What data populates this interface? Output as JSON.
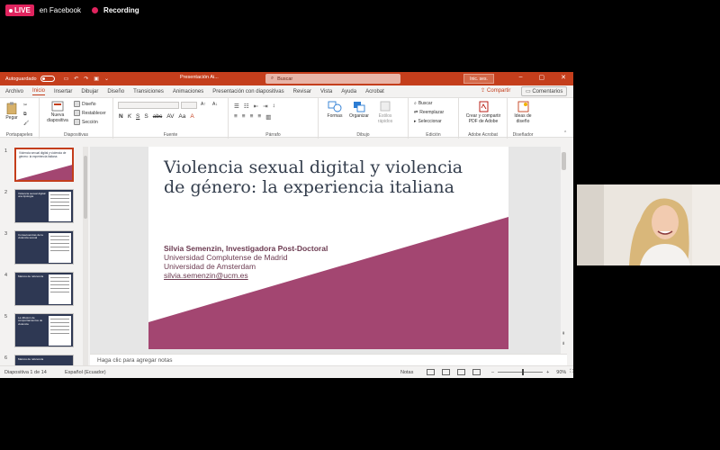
{
  "stream": {
    "live_label": "LIVE",
    "platform": "en Facebook",
    "recording_label": "Recording"
  },
  "window": {
    "autosave_label": "Autoguardado",
    "file_name": "Presentación Ai...",
    "search_placeholder": "Buscar",
    "signin_label": "Inic. ses."
  },
  "tabs": [
    "Archivo",
    "Inicio",
    "Insertar",
    "Dibujar",
    "Diseño",
    "Transiciones",
    "Animaciones",
    "Presentación con diapositivas",
    "Revisar",
    "Vista",
    "Ayuda",
    "Acrobat"
  ],
  "share_label": "Compartir",
  "comments_label": "Comentarios",
  "ribbon": {
    "paste": "Pegar",
    "new_slide": "Nueva diapositiva",
    "layout": "Diseño",
    "reset": "Restablecer",
    "section": "Sección",
    "shapes": "Formas",
    "arrange": "Organizar",
    "quick_styles": "Estilos rápidos",
    "find": "Buscar",
    "replace": "Reemplazar",
    "select": "Seleccionar",
    "create_pdf": "Crear y compartir PDF de Adobe",
    "design_ideas": "Ideas de diseño",
    "groups": {
      "clipboard": "Portapapeles",
      "slides": "Diapositivas",
      "font": "Fuente",
      "paragraph": "Párrafo",
      "drawing": "Dibujo",
      "editing": "Edición",
      "adobe": "Adobe Acrobat",
      "designer": "Diseñador"
    }
  },
  "thumbnails": [
    {
      "num": "1",
      "title": "Violencia sexual digital y violencia de género: la experiencia italiana"
    },
    {
      "num": "2",
      "title": "Violencia sexual digital: una tipología"
    },
    {
      "num": "3",
      "title": "Consecuencias de la violencia sexual"
    },
    {
      "num": "4",
      "title": "Marcos de referencia"
    },
    {
      "num": "5",
      "title": "La difusión de comportamientos de violencia"
    },
    {
      "num": "6",
      "title": "Marcos de referencia"
    }
  ],
  "slide": {
    "title": "Violencia sexual digital y violencia de género: la experiencia italiana",
    "author": "Silvia Semenzin, Investigadora Post-Doctoral",
    "affiliation1": "Universidad Complutense de Madrid",
    "affiliation2": "Universidad de Amsterdam",
    "email": "silvia.semenzin@ucm.es"
  },
  "notes_placeholder": "Haga clic para agregar notas",
  "status": {
    "slide_info": "Diapositiva 1 de 14",
    "language": "Español (Ecuador)",
    "notes_button": "Notas",
    "zoom": "90%"
  },
  "colors": {
    "accent": "#c43e1c",
    "slide_band": "#a34671",
    "title_text": "#333d4c"
  }
}
